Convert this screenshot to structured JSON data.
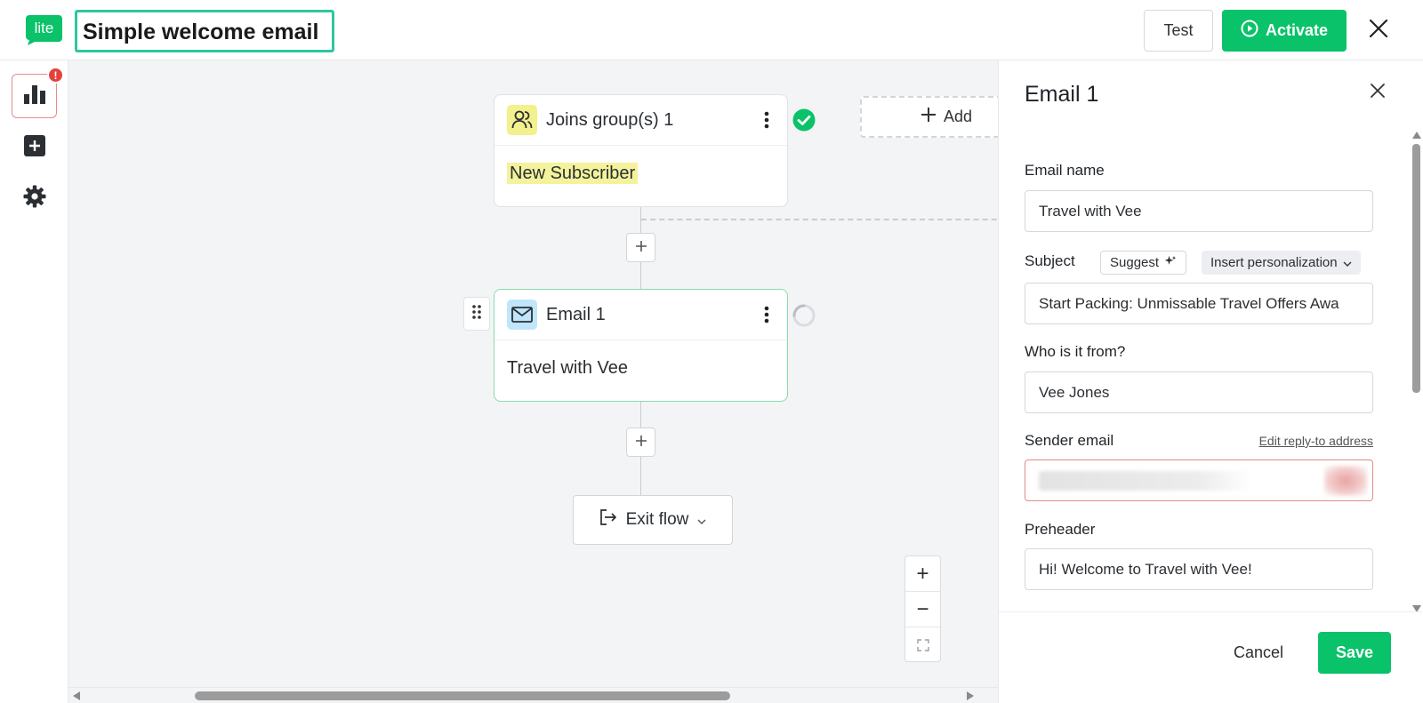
{
  "header": {
    "logo_text": "lite",
    "title": "Simple welcome email",
    "test_label": "Test",
    "activate_label": "Activate",
    "brand_color": "#09c269"
  },
  "sidebar": {
    "badge": "!",
    "items": [
      {
        "name": "stats",
        "icon": "bar-chart-icon"
      },
      {
        "name": "add",
        "icon": "plus-square-icon"
      },
      {
        "name": "settings",
        "icon": "gear-icon"
      }
    ]
  },
  "canvas": {
    "trigger_node": {
      "title": "Joins group(s) 1",
      "group_tag": "New Subscriber",
      "status": "complete"
    },
    "email_node": {
      "title": "Email 1",
      "subtitle": "Travel with Vee",
      "status": "loading"
    },
    "exit_node": {
      "label": "Exit flow"
    },
    "add_box": {
      "label": "Add"
    },
    "zoom": {
      "in": "+",
      "out": "−"
    }
  },
  "panel": {
    "title": "Email 1",
    "fields": {
      "email_name": {
        "label": "Email name",
        "value": "Travel with Vee"
      },
      "subject": {
        "label": "Subject",
        "value": "Start Packing: Unmissable Travel Offers Awa",
        "suggest_label": "Suggest",
        "personalization_label": "Insert personalization"
      },
      "from": {
        "label": "Who is it from?",
        "value": "Vee Jones"
      },
      "sender_email": {
        "label": "Sender email",
        "reply_link": "Edit reply-to address"
      },
      "preheader": {
        "label": "Preheader",
        "value": "Hi! Welcome to Travel with Vee!"
      }
    },
    "cancel_label": "Cancel",
    "save_label": "Save"
  }
}
